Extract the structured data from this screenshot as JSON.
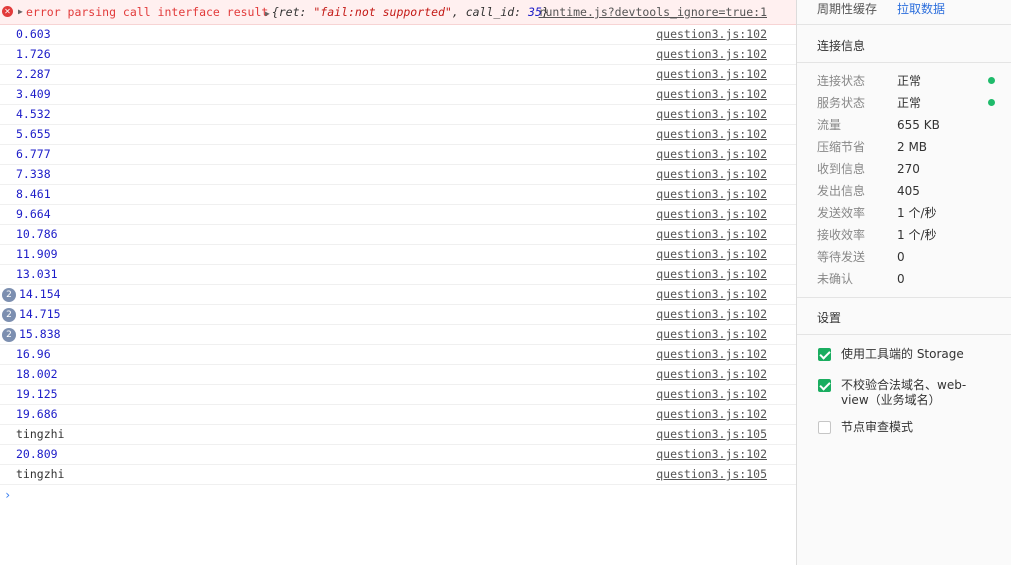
{
  "console": {
    "error": {
      "message": "error parsing call interface result",
      "object_prefix": "{ret: ",
      "object_ret": "\"fail:not supported\"",
      "object_mid": ", call_id: ",
      "object_id": "35",
      "object_suffix": "}",
      "source": "runtime.js?devtools_ignore=true:1"
    },
    "logs": [
      {
        "value": "0.603",
        "source": "question3.js:102",
        "repeat": "",
        "kind": "number"
      },
      {
        "value": "1.726",
        "source": "question3.js:102",
        "repeat": "",
        "kind": "number"
      },
      {
        "value": "2.287",
        "source": "question3.js:102",
        "repeat": "",
        "kind": "number"
      },
      {
        "value": "3.409",
        "source": "question3.js:102",
        "repeat": "",
        "kind": "number"
      },
      {
        "value": "4.532",
        "source": "question3.js:102",
        "repeat": "",
        "kind": "number"
      },
      {
        "value": "5.655",
        "source": "question3.js:102",
        "repeat": "",
        "kind": "number"
      },
      {
        "value": "6.777",
        "source": "question3.js:102",
        "repeat": "",
        "kind": "number"
      },
      {
        "value": "7.338",
        "source": "question3.js:102",
        "repeat": "",
        "kind": "number"
      },
      {
        "value": "8.461",
        "source": "question3.js:102",
        "repeat": "",
        "kind": "number"
      },
      {
        "value": "9.664",
        "source": "question3.js:102",
        "repeat": "",
        "kind": "number"
      },
      {
        "value": "10.786",
        "source": "question3.js:102",
        "repeat": "",
        "kind": "number"
      },
      {
        "value": "11.909",
        "source": "question3.js:102",
        "repeat": "",
        "kind": "number"
      },
      {
        "value": "13.031",
        "source": "question3.js:102",
        "repeat": "",
        "kind": "number"
      },
      {
        "value": "14.154",
        "source": "question3.js:102",
        "repeat": "2",
        "kind": "number"
      },
      {
        "value": "14.715",
        "source": "question3.js:102",
        "repeat": "2",
        "kind": "number"
      },
      {
        "value": "15.838",
        "source": "question3.js:102",
        "repeat": "2",
        "kind": "number"
      },
      {
        "value": "16.96",
        "source": "question3.js:102",
        "repeat": "",
        "kind": "number"
      },
      {
        "value": "18.002",
        "source": "question3.js:102",
        "repeat": "",
        "kind": "number"
      },
      {
        "value": "19.125",
        "source": "question3.js:102",
        "repeat": "",
        "kind": "number"
      },
      {
        "value": "19.686",
        "source": "question3.js:102",
        "repeat": "",
        "kind": "number"
      },
      {
        "value": "tingzhi",
        "source": "question3.js:105",
        "repeat": "",
        "kind": "text"
      },
      {
        "value": "20.809",
        "source": "question3.js:102",
        "repeat": "",
        "kind": "number"
      },
      {
        "value": "tingzhi",
        "source": "question3.js:105",
        "repeat": "",
        "kind": "text"
      }
    ],
    "prompt": "›"
  },
  "panel": {
    "periodic_cache_label": "周期性缓存",
    "fetch_data_link": "拉取数据",
    "connection": {
      "title": "连接信息",
      "rows": [
        {
          "key": "连接状态",
          "value": "正常",
          "dot": true
        },
        {
          "key": "服务状态",
          "value": "正常",
          "dot": true
        },
        {
          "key": "流量",
          "value": "655 KB",
          "dot": false
        },
        {
          "key": "压缩节省",
          "value": "2 MB",
          "dot": false
        },
        {
          "key": "收到信息",
          "value": "270",
          "dot": false
        },
        {
          "key": "发出信息",
          "value": "405",
          "dot": false
        },
        {
          "key": "发送效率",
          "value": "1 个/秒",
          "dot": false
        },
        {
          "key": "接收效率",
          "value": "1 个/秒",
          "dot": false
        },
        {
          "key": "等待发送",
          "value": "0",
          "dot": false
        },
        {
          "key": "未确认",
          "value": "0",
          "dot": false
        }
      ]
    },
    "settings": {
      "title": "设置",
      "options": [
        {
          "label": "使用工具端的 Storage",
          "checked": true
        },
        {
          "label": "不校验合法域名、web-view（业务域名）",
          "checked": true
        },
        {
          "label": "节点审查模式",
          "checked": false
        }
      ]
    },
    "status_color": "#1fbb6b",
    "checkbox_color": "#1aad60"
  }
}
